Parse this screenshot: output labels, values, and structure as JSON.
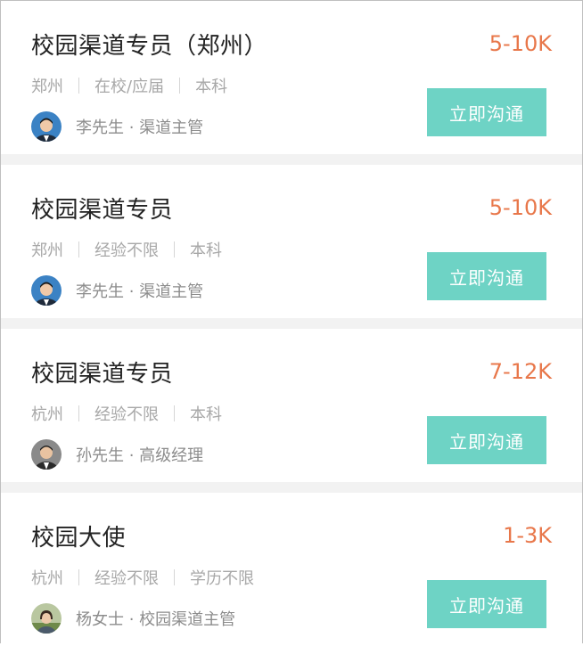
{
  "jobs": [
    {
      "title": "校园渠道专员（郑州）",
      "salary": "5-10K",
      "tags": [
        "郑州",
        "在校/应届",
        "本科"
      ],
      "recruiter": "李先生 · 渠道主管",
      "avatar": "male-avatar-blue",
      "button": "立即沟通"
    },
    {
      "title": "校园渠道专员",
      "salary": "5-10K",
      "tags": [
        "郑州",
        "经验不限",
        "本科"
      ],
      "recruiter": "李先生 · 渠道主管",
      "avatar": "male-avatar-blue",
      "button": "立即沟通"
    },
    {
      "title": "校园渠道专员",
      "salary": "7-12K",
      "tags": [
        "杭州",
        "经验不限",
        "本科"
      ],
      "recruiter": "孙先生 · 高级经理",
      "avatar": "male-avatar-suit",
      "button": "立即沟通"
    },
    {
      "title": "校园大使",
      "salary": "1-3K",
      "tags": [
        "杭州",
        "经验不限",
        "学历不限"
      ],
      "recruiter": "杨女士 · 校园渠道主管",
      "avatar": "female-avatar-outdoor",
      "button": "立即沟通"
    }
  ],
  "colors": {
    "salary": "#e8774a",
    "button": "#6ed3c5",
    "divider": "#f2f2f2"
  }
}
